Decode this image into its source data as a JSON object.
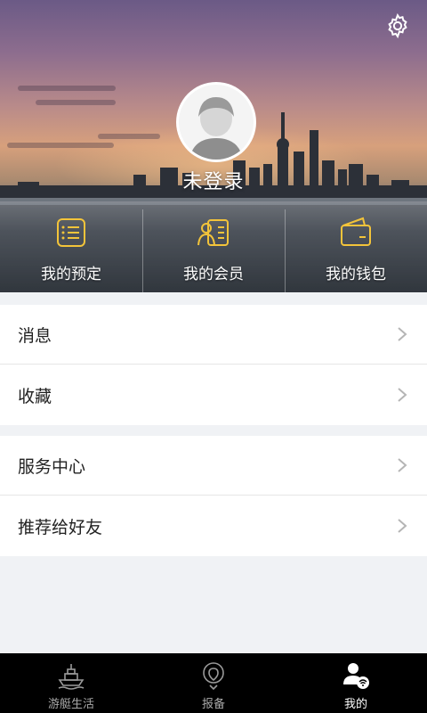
{
  "header": {
    "login_text": "未登录",
    "settings_icon": "gear-icon",
    "quick_links": [
      {
        "label": "我的预定",
        "icon": "list-icon"
      },
      {
        "label": "我的会员",
        "icon": "member-card-icon"
      },
      {
        "label": "我的钱包",
        "icon": "wallet-icon"
      }
    ],
    "accent_color": "#f3c43a"
  },
  "menu": {
    "group1": [
      {
        "label": "消息"
      },
      {
        "label": "收藏"
      }
    ],
    "group2": [
      {
        "label": "服务中心"
      },
      {
        "label": "推荐给好友"
      }
    ]
  },
  "tabbar": {
    "tabs": [
      {
        "label": "游艇生活",
        "icon": "yacht-icon"
      },
      {
        "label": "报备",
        "icon": "location-pin-icon"
      },
      {
        "label": "我的",
        "icon": "user-profile-icon",
        "active": true
      }
    ]
  }
}
